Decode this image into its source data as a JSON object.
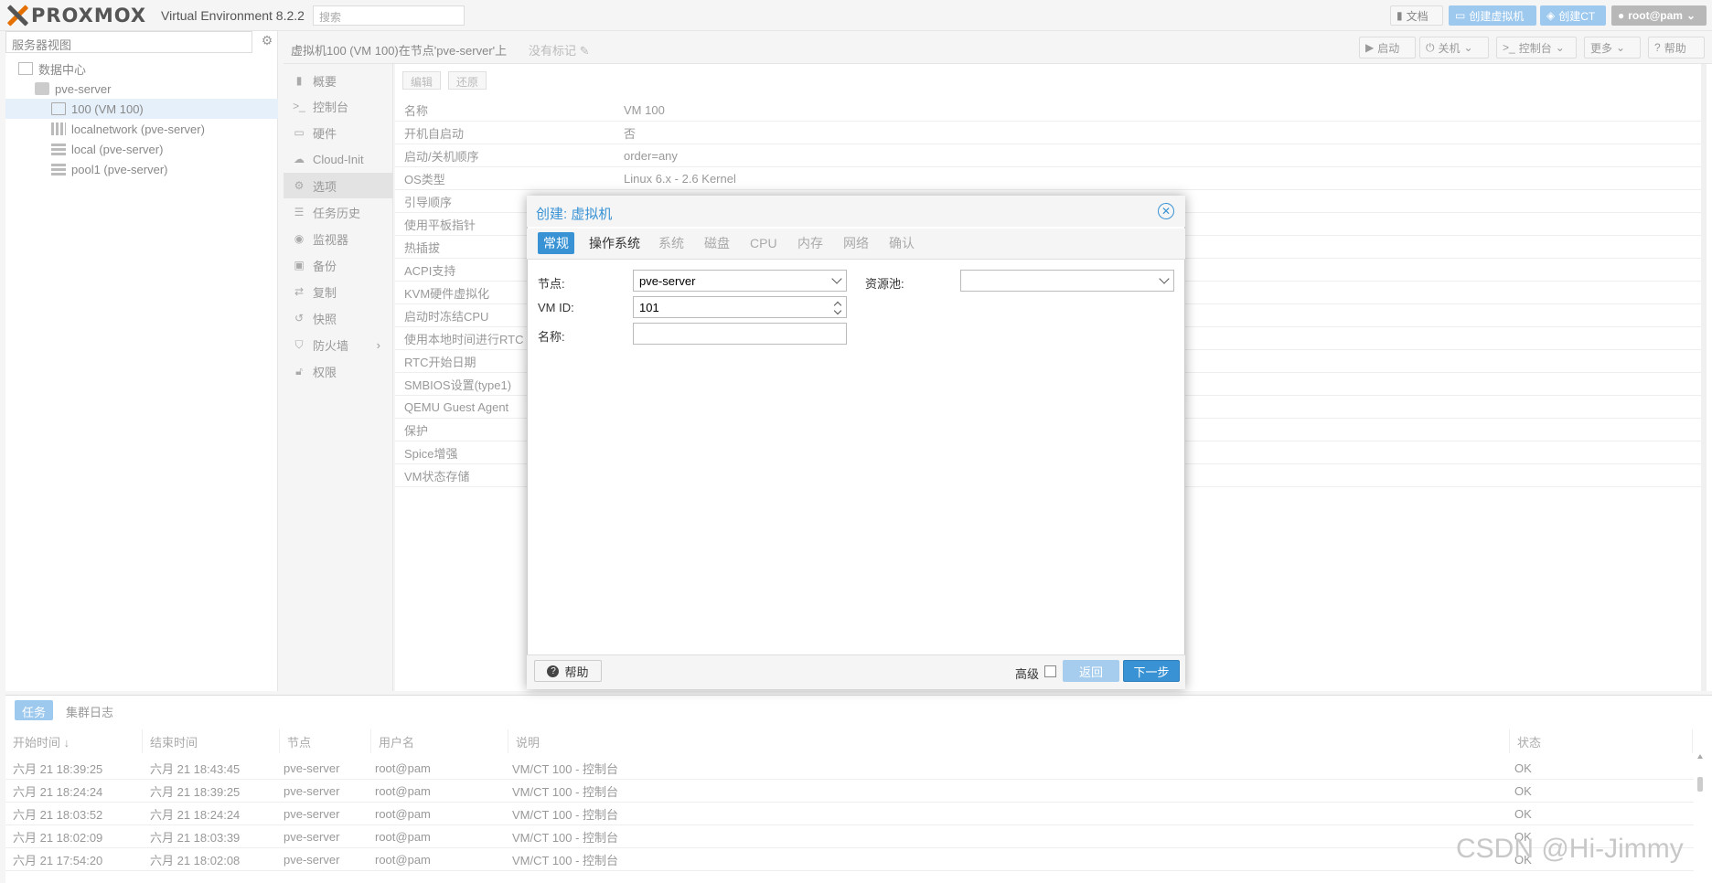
{
  "topbar": {
    "logo": "PROXMOX",
    "version": "Virtual Environment 8.2.2",
    "search_placeholder": "搜索",
    "docs": "文档",
    "create_vm": "创建虚拟机",
    "create_ct": "创建CT",
    "user": "root@pam"
  },
  "tree": {
    "view": "服务器视图",
    "items": [
      {
        "label": "数据中心"
      },
      {
        "label": "pve-server"
      },
      {
        "label": "100 (VM 100)"
      },
      {
        "label": "localnetwork (pve-server)"
      },
      {
        "label": "local (pve-server)"
      },
      {
        "label": "pool1 (pve-server)"
      }
    ]
  },
  "header": {
    "title": "虚拟机100 (VM 100)在节点'pve-server'上",
    "no_tags": "没有标记",
    "start": "启动",
    "shutdown": "关机",
    "console": "控制台",
    "more": "更多",
    "help": "帮助"
  },
  "nav": {
    "items": [
      "概要",
      "控制台",
      "硬件",
      "Cloud-Init",
      "选项",
      "任务历史",
      "监视器",
      "备份",
      "复制",
      "快照",
      "防火墙",
      "权限"
    ]
  },
  "options": {
    "edit": "编辑",
    "revert": "还原",
    "rows": [
      {
        "key": "名称",
        "value": "VM 100"
      },
      {
        "key": "开机自启动",
        "value": "否"
      },
      {
        "key": "启动/关机顺序",
        "value": "order=any"
      },
      {
        "key": "OS类型",
        "value": "Linux 6.x - 2.6 Kernel"
      },
      {
        "key": "引导顺序",
        "value": ""
      },
      {
        "key": "使用平板指针",
        "value": ""
      },
      {
        "key": "热插拔",
        "value": ""
      },
      {
        "key": "ACPI支持",
        "value": ""
      },
      {
        "key": "KVM硬件虚拟化",
        "value": ""
      },
      {
        "key": "启动时冻结CPU",
        "value": ""
      },
      {
        "key": "使用本地时间进行RTC",
        "value": ""
      },
      {
        "key": "RTC开始日期",
        "value": ""
      },
      {
        "key": "SMBIOS设置(type1)",
        "value": ""
      },
      {
        "key": "QEMU Guest Agent",
        "value": ""
      },
      {
        "key": "保护",
        "value": ""
      },
      {
        "key": "Spice增强",
        "value": ""
      },
      {
        "key": "VM状态存储",
        "value": ""
      }
    ]
  },
  "modal": {
    "title": "创建: 虚拟机",
    "tabs": [
      "常规",
      "操作系统",
      "系统",
      "磁盘",
      "CPU",
      "内存",
      "网络",
      "确认"
    ],
    "node_label": "节点:",
    "node_value": "pve-server",
    "vmid_label": "VM ID:",
    "vmid_value": "101",
    "name_label": "名称:",
    "name_value": "",
    "pool_label": "资源池:",
    "pool_value": "",
    "help": "帮助",
    "advanced": "高级",
    "back": "返回",
    "next": "下一步"
  },
  "tasks": {
    "tabs": [
      "任务",
      "集群日志"
    ],
    "columns": [
      "开始时间 ↓",
      "结束时间",
      "节点",
      "用户名",
      "说明",
      "状态"
    ],
    "rows": [
      [
        "六月 21 18:39:25",
        "六月 21 18:43:45",
        "pve-server",
        "root@pam",
        "VM/CT 100 - 控制台",
        "OK"
      ],
      [
        "六月 21 18:24:24",
        "六月 21 18:39:25",
        "pve-server",
        "root@pam",
        "VM/CT 100 - 控制台",
        "OK"
      ],
      [
        "六月 21 18:03:52",
        "六月 21 18:24:24",
        "pve-server",
        "root@pam",
        "VM/CT 100 - 控制台",
        "OK"
      ],
      [
        "六月 21 18:02:09",
        "六月 21 18:03:39",
        "pve-server",
        "root@pam",
        "VM/CT 100 - 控制台",
        "OK"
      ],
      [
        "六月 21 17:54:20",
        "六月 21 18:02:08",
        "pve-server",
        "root@pam",
        "VM/CT 100 - 控制台",
        "OK"
      ]
    ]
  },
  "watermark": "CSDN @Hi-Jimmy"
}
